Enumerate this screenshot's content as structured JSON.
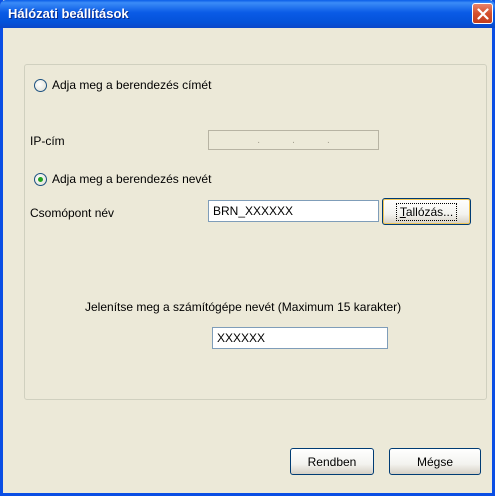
{
  "window": {
    "title": "Hálózati beállítások"
  },
  "option_address": {
    "label": "Adja meg a berendezés címét",
    "selected": false
  },
  "ip": {
    "label": "IP-cím",
    "separator": "."
  },
  "option_name": {
    "label": "Adja meg a berendezés nevét",
    "selected": true
  },
  "node": {
    "label": "Csomópont név",
    "value": "BRN_XXXXXX",
    "browse_label": "Tallózás...",
    "browse_accel": "T"
  },
  "computer": {
    "label": "Jelenítse meg a számítógépe nevét (Maximum 15 karakter)",
    "value": "XXXXXX"
  },
  "buttons": {
    "ok_label": "Rendben",
    "cancel_label": "Mégse"
  }
}
